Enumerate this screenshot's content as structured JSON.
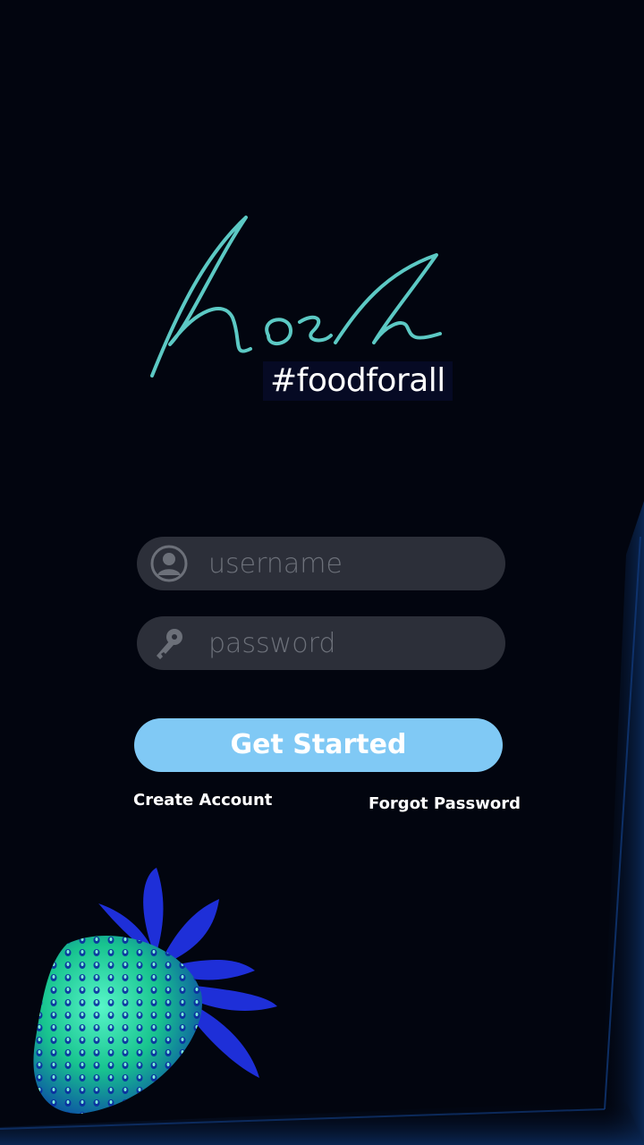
{
  "brand": {
    "logo_text": "Nosh",
    "tagline": "#foodforall",
    "logo_color": "#5cc9c4"
  },
  "login": {
    "username": {
      "placeholder": "username",
      "icon": "user-avatar-icon"
    },
    "password": {
      "placeholder": "password",
      "icon": "key-icon"
    },
    "submit_label": "Get Started",
    "create_account_label": "Create Account",
    "forgot_password_label": "Forgot Password"
  },
  "colors": {
    "background": "#02050f",
    "field": "#2c2f39",
    "button": "#80c9f5",
    "tagline_bg": "#060a24"
  },
  "decoration": {
    "image": "strawberry-image"
  }
}
